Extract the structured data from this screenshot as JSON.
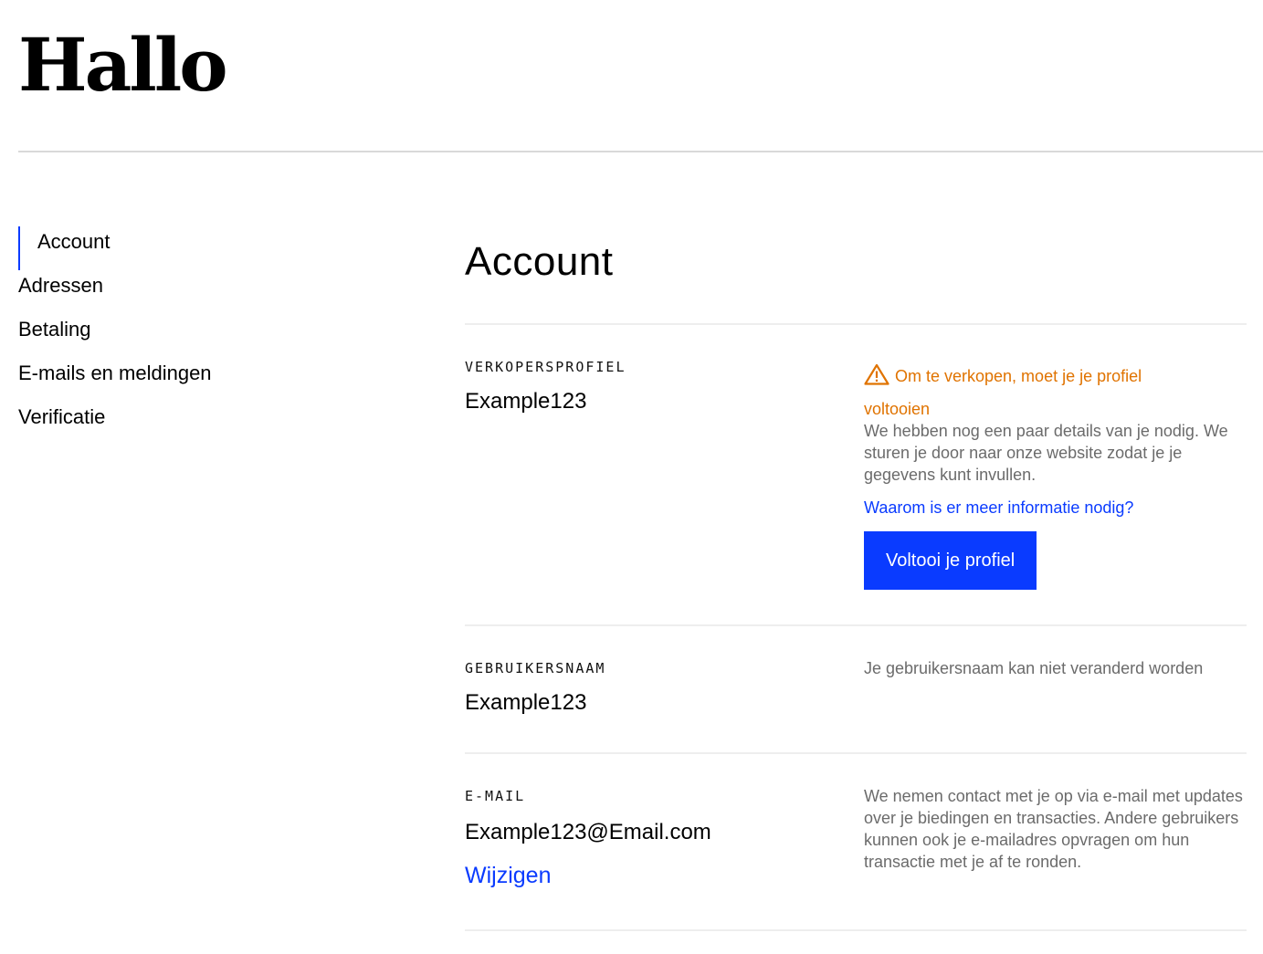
{
  "header": {
    "title": "Hallo"
  },
  "sidebar": {
    "items": [
      {
        "label": "Account",
        "active": true
      },
      {
        "label": "Adressen"
      },
      {
        "label": "Betaling"
      },
      {
        "label": "E-mails en meldingen"
      },
      {
        "label": "Verificatie"
      }
    ]
  },
  "main": {
    "title": "Account",
    "seller_profile": {
      "label": "VERKOPERSPROFIEL",
      "value": "Example123",
      "warning_line1": "Om te verkopen, moet je je profiel",
      "warning_line2": "voltooien",
      "warning_icon": "warning-triangle-icon",
      "description": "We hebben nog een paar details van je nodig. We sturen je door naar onze website zodat je je gegevens kunt invullen.",
      "info_link": "Waarom is er meer informatie nodig?",
      "button_label": "Voltooi je profiel"
    },
    "username": {
      "label": "GEBRUIKERSNAAM",
      "value": "Example123",
      "note": "Je gebruikersnaam kan niet veranderd worden"
    },
    "email": {
      "label": "E-MAIL",
      "value": "Example123@Email.com",
      "change_link": "Wijzigen",
      "note": "We nemen contact met je op via e-mail met updates over je biedingen en transacties. Andere gebruikers kunnen ook je e-mailadres opvragen om hun transactie met je af te ronden."
    }
  },
  "colors": {
    "accent": "#0a3bff",
    "warning": "#e07300",
    "muted_text": "#6b6b6b",
    "divider": "#eeeeee"
  }
}
